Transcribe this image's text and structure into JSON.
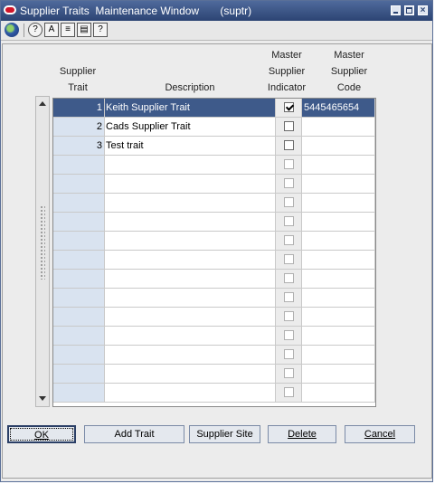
{
  "window": {
    "title": "Supplier Traits  Maintenance Window       (suptr)"
  },
  "toolbar": {
    "icons": [
      "globe-icon",
      "help-icon",
      "cue-card-icon",
      "navigator-icon",
      "notes-icon",
      "about-icon"
    ]
  },
  "table": {
    "headers": {
      "trait": "Supplier\nTrait",
      "description": "Description",
      "master_indicator": "Master\nSupplier\nIndicator",
      "master_code": "Master\nSupplier\nCode"
    },
    "rows": [
      {
        "trait": "1",
        "description": "Keith Supplier Trait",
        "indicator": true,
        "code": "5445465654"
      },
      {
        "trait": "2",
        "description": "Cads Supplier Trait",
        "indicator": false,
        "code": ""
      },
      {
        "trait": "3",
        "description": "Test trait",
        "indicator": false,
        "code": ""
      }
    ],
    "empty_rows": 13,
    "selected_row": 0
  },
  "buttons": {
    "ok": "OK",
    "add_trait": "Add Trait",
    "supplier_site": "Supplier Site",
    "delete": "Delete",
    "cancel": "Cancel"
  },
  "colors": {
    "title_bar": "#2c4473",
    "selection": "#3e5a8a",
    "key_column": "#d9e3f0"
  }
}
